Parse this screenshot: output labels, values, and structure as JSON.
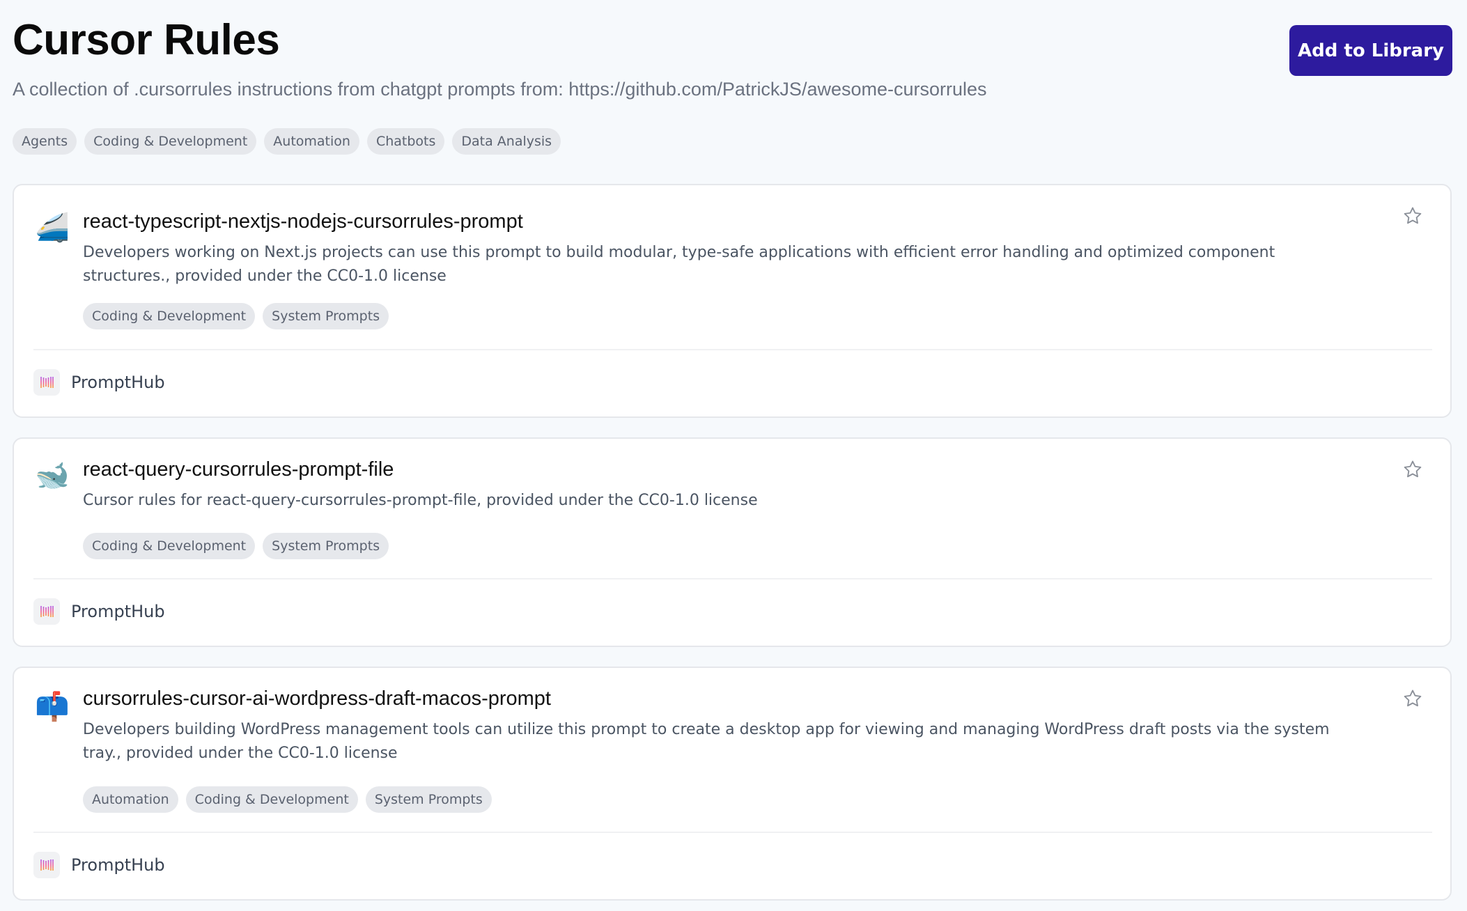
{
  "header": {
    "title": "Cursor Rules",
    "subtitle": "A collection of .cursorrules instructions from chatgpt prompts from: https://github.com/PatrickJS/awesome-cursorrules",
    "add_button_label": "Add to Library",
    "tags": [
      "Agents",
      "Coding & Development",
      "Automation",
      "Chatbots",
      "Data Analysis"
    ]
  },
  "colors": {
    "accent": "#2d1b9e",
    "page_background": "#f6f9fc",
    "tag_background": "#e6e8ec",
    "tag_text": "#5b6270"
  },
  "cards": [
    {
      "icon": "🚄",
      "icon_name": "high-speed-train-icon",
      "title": "react-typescript-nextjs-nodejs-cursorrules-prompt",
      "description": "Developers working on Next.js projects can use this prompt to build modular, type-safe applications with efficient error handling and optimized component structures., provided under the CC0-1.0 license",
      "tags": [
        "Coding & Development",
        "System Prompts"
      ],
      "favorite_icon": "star-outline-icon",
      "footer": {
        "source": "PromptHub",
        "logo": "prompthub-logo-icon"
      }
    },
    {
      "icon": "🐋",
      "icon_name": "whale-icon",
      "title": "react-query-cursorrules-prompt-file",
      "description": "Cursor rules for react-query-cursorrules-prompt-file, provided under the CC0-1.0 license",
      "tags": [
        "Coding & Development",
        "System Prompts"
      ],
      "favorite_icon": "star-outline-icon",
      "footer": {
        "source": "PromptHub",
        "logo": "prompthub-logo-icon"
      }
    },
    {
      "icon": "📫",
      "icon_name": "mailbox-icon",
      "title": "cursorrules-cursor-ai-wordpress-draft-macos-prompt",
      "description": "Developers building WordPress management tools can utilize this prompt to create a desktop app for viewing and managing WordPress draft posts via the system tray., provided under the CC0-1.0 license",
      "tags": [
        "Automation",
        "Coding & Development",
        "System Prompts"
      ],
      "favorite_icon": "star-outline-icon",
      "footer": {
        "source": "PromptHub",
        "logo": "prompthub-logo-icon"
      }
    }
  ]
}
